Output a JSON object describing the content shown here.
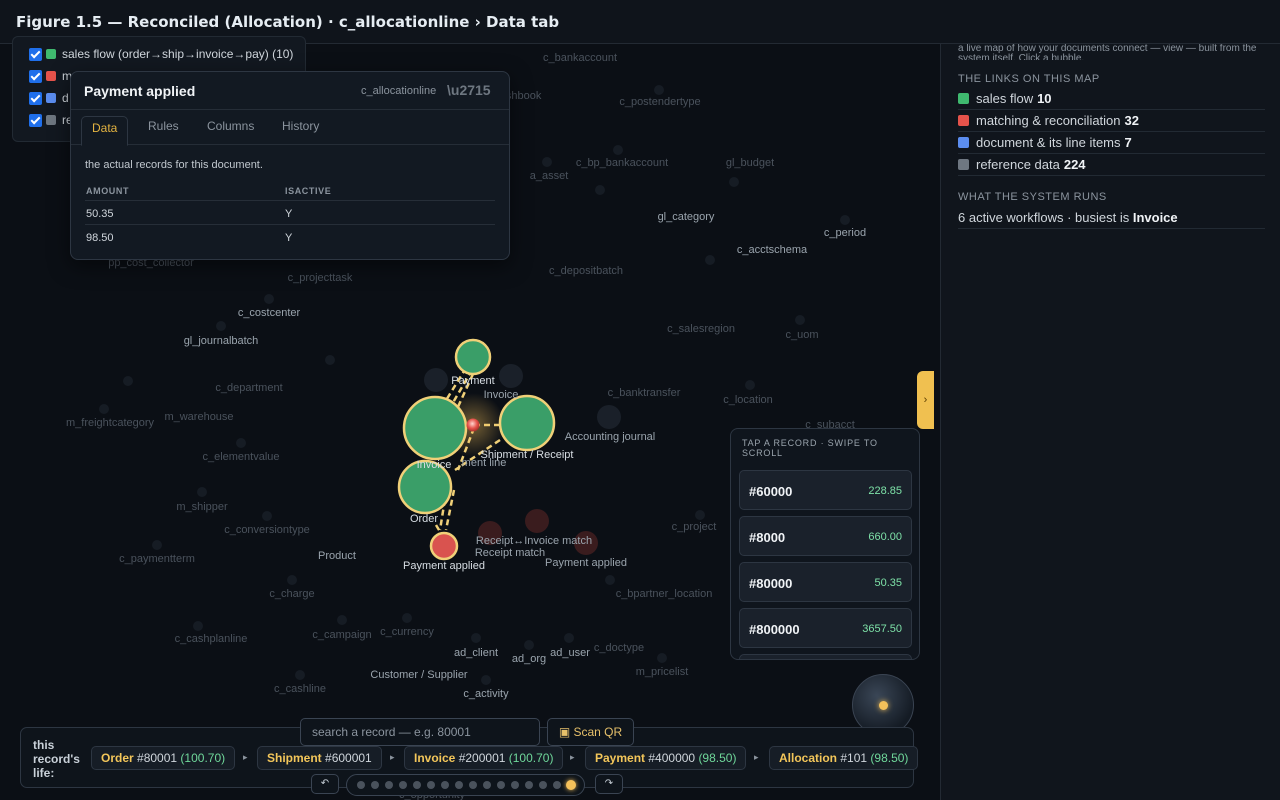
{
  "header": {
    "title": "Figure 1.5 — Reconciled (Allocation) · c_allocationline › Data tab"
  },
  "map": {
    "labels": [
      "c_bankaccount",
      "c_cashbook",
      "c_postendertype",
      "c_bp_bankaccount",
      "gl_budget",
      "a_asset",
      "gl_category",
      "c_period",
      "c_acctschema",
      "c_depositbatch",
      "pp_cost_collector",
      "c_projecttask",
      "c_costcenter",
      "gl_journalbatch",
      "c_salesregion",
      "c_uom",
      "c_department",
      "c_banktransfer",
      "c_location",
      "m_freightcategory",
      "m_warehouse",
      "c_subacct",
      "Accounting journal",
      "c_elementvalue",
      "m_shipper",
      "c_conversiontype",
      "c_project",
      "c_paymentterm",
      "Product",
      "Receipt↔Invoice match",
      "Receipt match",
      "Payment applied",
      "c_charge",
      "c_bpartner_location",
      "c_cashplanline",
      "c_campaign",
      "c_currency",
      "c_doctype",
      "ad_client",
      "ad_org",
      "ad_user",
      "Customer / Supplier",
      "m_pricelist",
      "c_cashline",
      "c_activity",
      "Invoice",
      "ment line",
      "Payment",
      "Invoice",
      "Shipment / Receipt",
      "Order",
      "Payment applied",
      "c_opportunity"
    ]
  },
  "filters": [
    {
      "label": "sales flow (order→ship→invoice→pay) (10)",
      "color": "#3fb96f"
    },
    {
      "label": "m",
      "color": "#e5534b"
    },
    {
      "label": "d",
      "color": "#5b8def"
    },
    {
      "label": "re",
      "color": "#6e7781"
    }
  ],
  "popup": {
    "title": "Payment applied",
    "table": "c_allocationline",
    "close": "\\u2715",
    "tabs": [
      "Data",
      "Rules",
      "Columns",
      "History"
    ],
    "description": "the actual records for this document.",
    "columns": [
      "AMOUNT",
      "ISACTIVE"
    ],
    "rows": [
      {
        "amount": "50.35",
        "isactive": "Y"
      },
      {
        "amount": "98.50",
        "isactive": "Y"
      }
    ]
  },
  "side": {
    "intro": "a live map of how your documents connect — view — built from the system itself. Click a bubble.",
    "links_heading": "THE LINKS ON THIS MAP",
    "links": [
      {
        "label": "sales flow",
        "count": "10",
        "color": "#3fb96f"
      },
      {
        "label": "matching & reconciliation",
        "count": "32",
        "color": "#e5534b"
      },
      {
        "label": "document & its line items",
        "count": "7",
        "color": "#5b8def"
      },
      {
        "label": "reference data",
        "count": "224",
        "color": "#6e7781"
      }
    ],
    "runs_heading": "WHAT THE SYSTEM RUNS",
    "runs_text": "6 active workflows · busiest is ",
    "runs_bold": "Invoice"
  },
  "edge_tab": "›",
  "records": {
    "heading": "TAP A RECORD · SWIPE TO SCROLL",
    "items": [
      {
        "id": "#60000",
        "amount": "228.85"
      },
      {
        "id": "#8000",
        "amount": "660.00"
      },
      {
        "id": "#80000",
        "amount": "50.35"
      },
      {
        "id": "#800000",
        "amount": "3657.50"
      },
      {
        "id": "",
        "amount": ""
      }
    ]
  },
  "orbit": {
    "label": "orbit"
  },
  "life": {
    "label": "this record's life:",
    "steps": [
      {
        "doc": "Order",
        "num": "#80001",
        "amt": "(100.70)"
      },
      {
        "doc": "Shipment",
        "num": "#600001",
        "amt": ""
      },
      {
        "doc": "Invoice",
        "num": "#200001",
        "amt": "(100.70)"
      },
      {
        "doc": "Payment",
        "num": "#400000",
        "amt": "(98.50)"
      },
      {
        "doc": "Allocation",
        "num": "#101",
        "amt": "(98.50)"
      }
    ],
    "arrow": "▸"
  },
  "search": {
    "placeholder": "search a record — e.g. 80001",
    "scan_label": "▣ Scan QR"
  },
  "timeline": {
    "prev": "↶",
    "next": "↷",
    "steps": 16,
    "current": 15
  },
  "colors": {
    "accent": "#f5c15a",
    "green_node": "#3a9e68",
    "red_node": "#d9534f",
    "edge": "#f0d078"
  }
}
